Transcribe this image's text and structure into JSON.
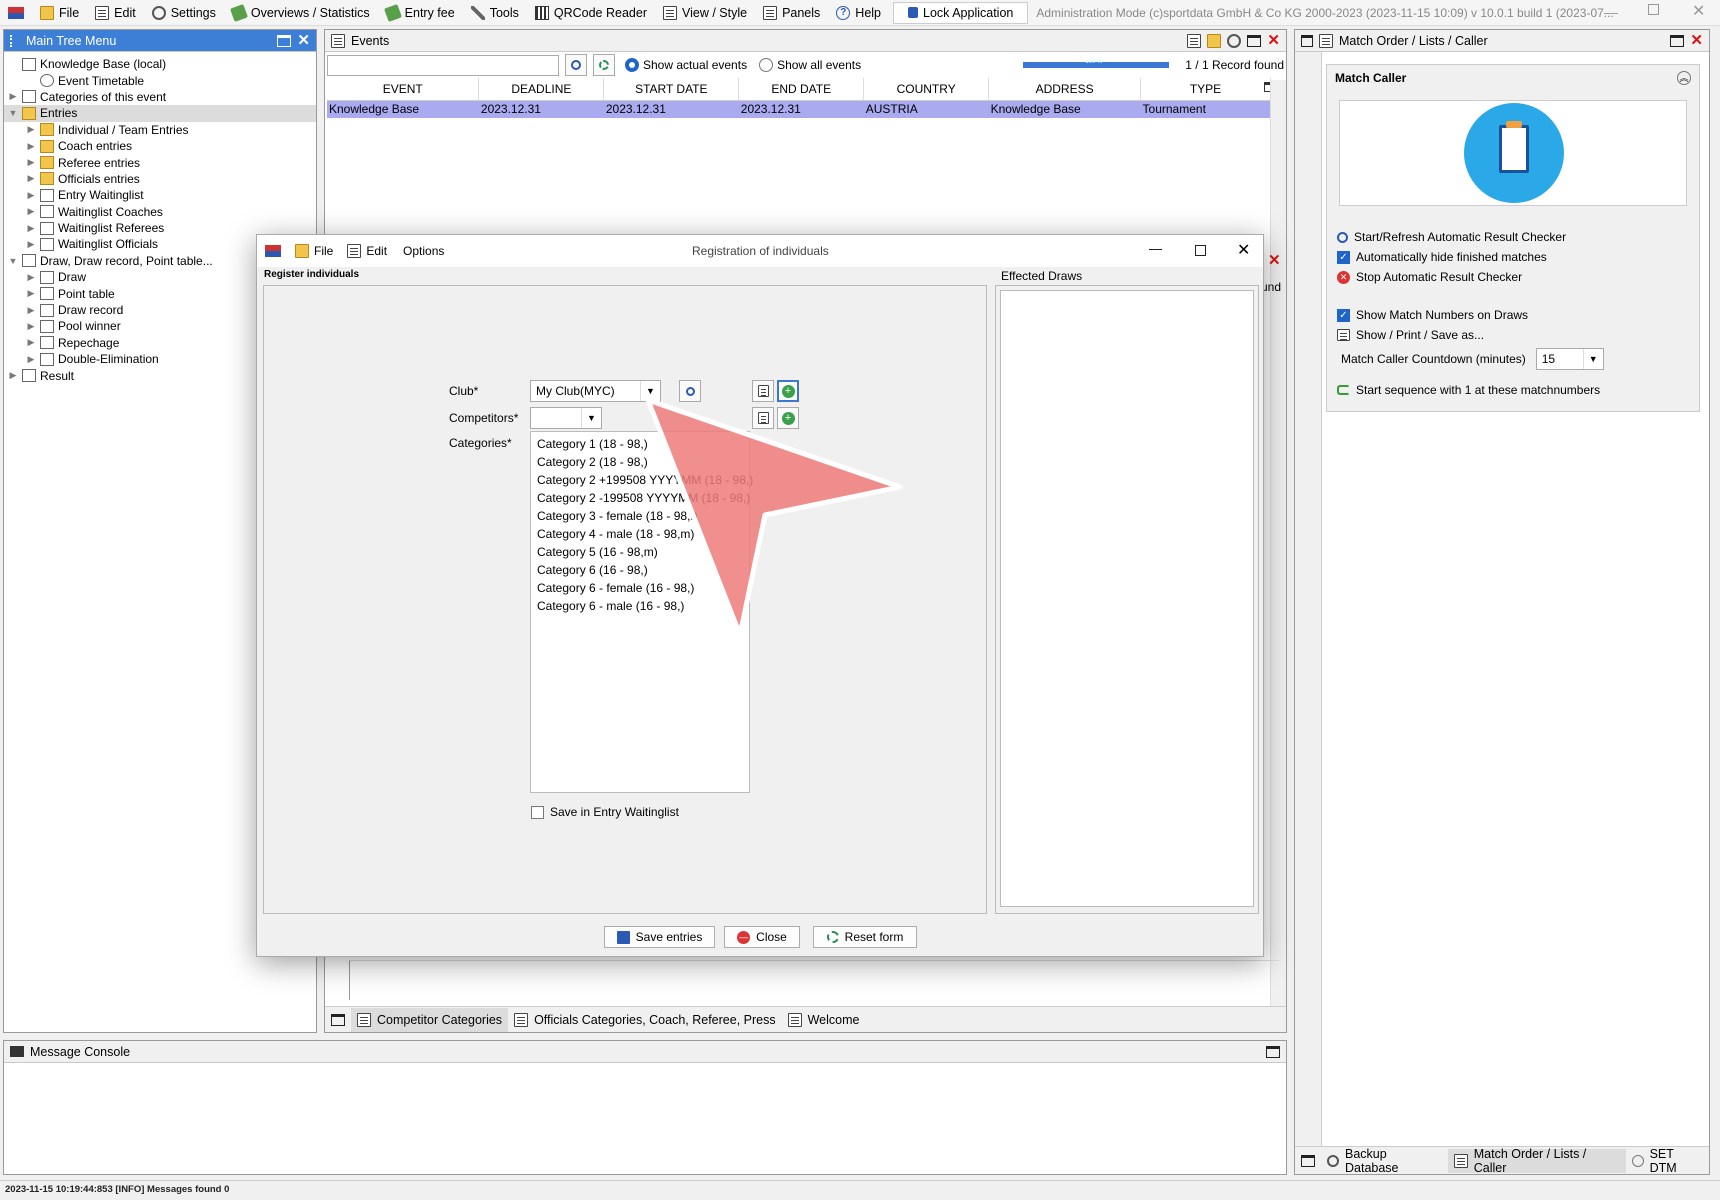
{
  "menubar": {
    "items": [
      "File",
      "Edit",
      "Settings",
      "Overviews / Statistics",
      "Entry fee",
      "Tools",
      "QRCode Reader",
      "View / Style",
      "Panels",
      "Help"
    ],
    "lock_label": "Lock Application",
    "status_text": "Administration Mode (c)sportdata GmbH & Co KG 2000-2023 (2023-11-15 10:09)  v 10.0.1 build 1 (2023-07..."
  },
  "tree": {
    "title": "Main Tree Menu",
    "nodes": [
      {
        "label": "Knowledge Base (local)",
        "icon": "database-icon"
      },
      {
        "label": "Event Timetable",
        "icon": "clock-icon"
      },
      {
        "label": "Categories of this event",
        "icon": "categories-icon"
      },
      {
        "label": "Entries",
        "icon": "folder-icon"
      },
      {
        "label": "Individual / Team Entries",
        "icon": "folder-icon"
      },
      {
        "label": "Coach entries",
        "icon": "folder-icon"
      },
      {
        "label": "Referee entries",
        "icon": "folder-icon"
      },
      {
        "label": "Officials entries",
        "icon": "folder-icon"
      },
      {
        "label": "Entry Waitinglist",
        "icon": "list-icon"
      },
      {
        "label": "Waitinglist Coaches",
        "icon": "list-icon"
      },
      {
        "label": "Waitinglist Referees",
        "icon": "list-icon"
      },
      {
        "label": "Waitinglist Officials",
        "icon": "list-icon"
      },
      {
        "label": "Draw, Draw record, Point table...",
        "icon": "draw-icon"
      },
      {
        "label": "Draw",
        "icon": "draw-icon"
      },
      {
        "label": "Point table",
        "icon": "table-icon"
      },
      {
        "label": "Draw record",
        "icon": "record-icon"
      },
      {
        "label": "Pool winner",
        "icon": "pool-icon"
      },
      {
        "label": "Repechage",
        "icon": "repechage-icon"
      },
      {
        "label": "Double-Elimination",
        "icon": "bracket-icon"
      },
      {
        "label": "Result",
        "icon": "result-icon"
      }
    ]
  },
  "events": {
    "title": "Events",
    "search_value": "",
    "filter_actual": "Show actual events",
    "filter_all": "Show all events",
    "progress_value": 1.0,
    "progress_text": "100 %",
    "record_count": "1 / 1 Record found",
    "columns": [
      "EVENT",
      "DEADLINE",
      "START DATE",
      "END DATE",
      "COUNTRY",
      "ADDRESS",
      "TYPE"
    ],
    "rows": [
      [
        "Knowledge Base",
        "2023.12.31",
        "2023.12.31",
        "2023.12.31",
        "AUSTRIA",
        "Knowledge Base",
        "Tournament"
      ]
    ],
    "behind_fragment": "und"
  },
  "dialog": {
    "title": "Registration of individuals",
    "menu": [
      "File",
      "Edit",
      "Options"
    ],
    "section_label": "Register individuals",
    "effected_draws_label": "Effected Draws",
    "club_label": "Club*",
    "club_value": "My Club(MYC)",
    "competitors_label": "Competitors*",
    "competitors_value": "",
    "categories_label": "Categories*",
    "categories": [
      "Category 1 (18 - 98,)",
      "Category 2 (18 - 98,)",
      "Category 2 +199508 YYYYMM (18 - 98,)",
      "Category 2 -199508 YYYYMM (18 - 98,)",
      "Category 3 - female (18 - 98,f)",
      "Category 4 - male (18 - 98,m)",
      "Category 5 (16 - 98,m)",
      "Category 6 (16 - 98,)",
      "Category 6 - female (16 - 98,)",
      "Category 6 - male (16 - 98,)"
    ],
    "waitinglist_label": "Save in Entry Waitinglist",
    "save_label": "Save entries",
    "close_label": "Close",
    "reset_label": "Reset form"
  },
  "bottom_tabs": [
    "Competitor Categories",
    "Officials Categories, Coach, Referee, Press",
    "Welcome"
  ],
  "console": {
    "title": "Message Console"
  },
  "match_panel": {
    "title": "Match Order / Lists / Caller",
    "section_title": "Match Caller",
    "items": [
      {
        "label": "Start/Refresh Automatic Result Checker",
        "icon": "magnifier-icon"
      },
      {
        "label": "Automatically hide finished matches",
        "icon": "checkbox-checked"
      },
      {
        "label": "Stop Automatic Result Checker",
        "icon": "stop-icon"
      },
      {
        "label": "Show Match Numbers on Draws",
        "icon": "checkbox-checked"
      },
      {
        "label": "Show / Print / Save as...",
        "icon": "printer-icon"
      }
    ],
    "countdown_label": "Match Caller Countdown (minutes)",
    "countdown_value": "15",
    "sequence_label": "Start sequence with 1 at these matchnumbers",
    "tabs": [
      "Backup Database",
      "Match Order / Lists / Caller",
      "SET DTM"
    ]
  },
  "statusbar": {
    "text": "2023-11-15 10:19:44:853 [INFO] Messages found 0"
  },
  "colors": {
    "selection": "#3d7fd6",
    "row_highlight": "#aaaaf0",
    "pointer": "#ef7b7b",
    "caller_icon": "#2ba8e8"
  }
}
